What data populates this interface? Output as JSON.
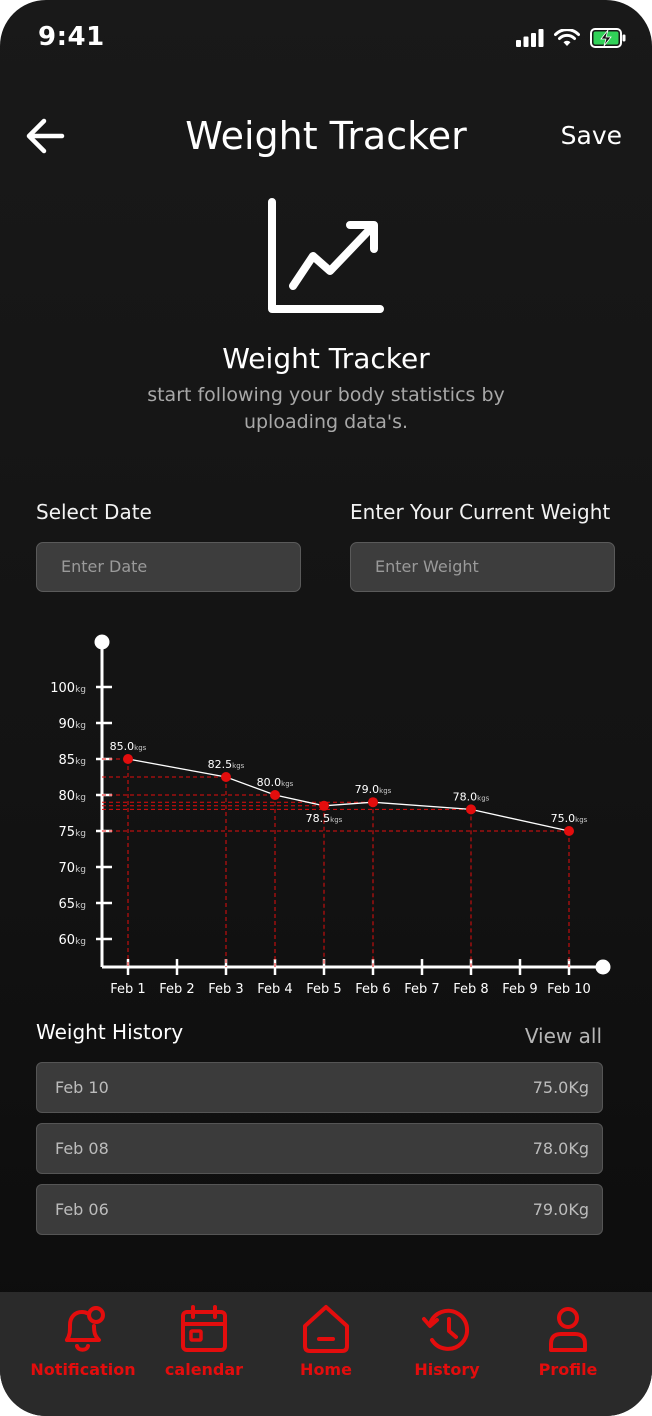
{
  "status": {
    "time": "9:41"
  },
  "header": {
    "title": "Weight Tracker",
    "save_label": "Save"
  },
  "hero": {
    "title": "Weight Tracker",
    "subtitle": "start following your body statistics by uploading data's."
  },
  "form": {
    "date_label": "Select Date",
    "date_placeholder": "Enter Date",
    "weight_label": "Enter Your Current Weight",
    "weight_placeholder": "Enter Weight"
  },
  "chart_data": {
    "type": "line",
    "x_labels": [
      "Feb 1",
      "Feb 2",
      "Feb 3",
      "Feb 4",
      "Feb 5",
      "Feb 6",
      "Feb 7",
      "Feb 8",
      "Feb 9",
      "Feb 10"
    ],
    "y_ticks": [
      100,
      90,
      85,
      80,
      75,
      70,
      65,
      60
    ],
    "y_unit": "kg",
    "point_unit": "kgs",
    "points": [
      {
        "x": "Feb 1",
        "y": 85.0
      },
      {
        "x": "Feb 3",
        "y": 82.5
      },
      {
        "x": "Feb 4",
        "y": 80.0
      },
      {
        "x": "Feb 5",
        "y": 78.5
      },
      {
        "x": "Feb 6",
        "y": 79.0
      },
      {
        "x": "Feb 8",
        "y": 78.0
      },
      {
        "x": "Feb 10",
        "y": 75.0
      }
    ],
    "line_color": "#ffffff",
    "point_color": "#e30d0d"
  },
  "history": {
    "title": "Weight History",
    "view_all": "View all",
    "rows": [
      {
        "date": "Feb 10",
        "weight": "75.0Kg"
      },
      {
        "date": "Feb 08",
        "weight": "78.0Kg"
      },
      {
        "date": "Feb 06",
        "weight": "79.0Kg"
      }
    ]
  },
  "nav": {
    "items": [
      {
        "label": "Notification",
        "icon": "bell-icon"
      },
      {
        "label": "calendar",
        "icon": "calendar-icon"
      },
      {
        "label": "Home",
        "icon": "home-icon"
      },
      {
        "label": "History",
        "icon": "history-icon"
      },
      {
        "label": "Profile",
        "icon": "profile-icon"
      }
    ]
  },
  "colors": {
    "accent": "#e30d0d",
    "background": "#161616",
    "field": "#3d3d3d"
  }
}
